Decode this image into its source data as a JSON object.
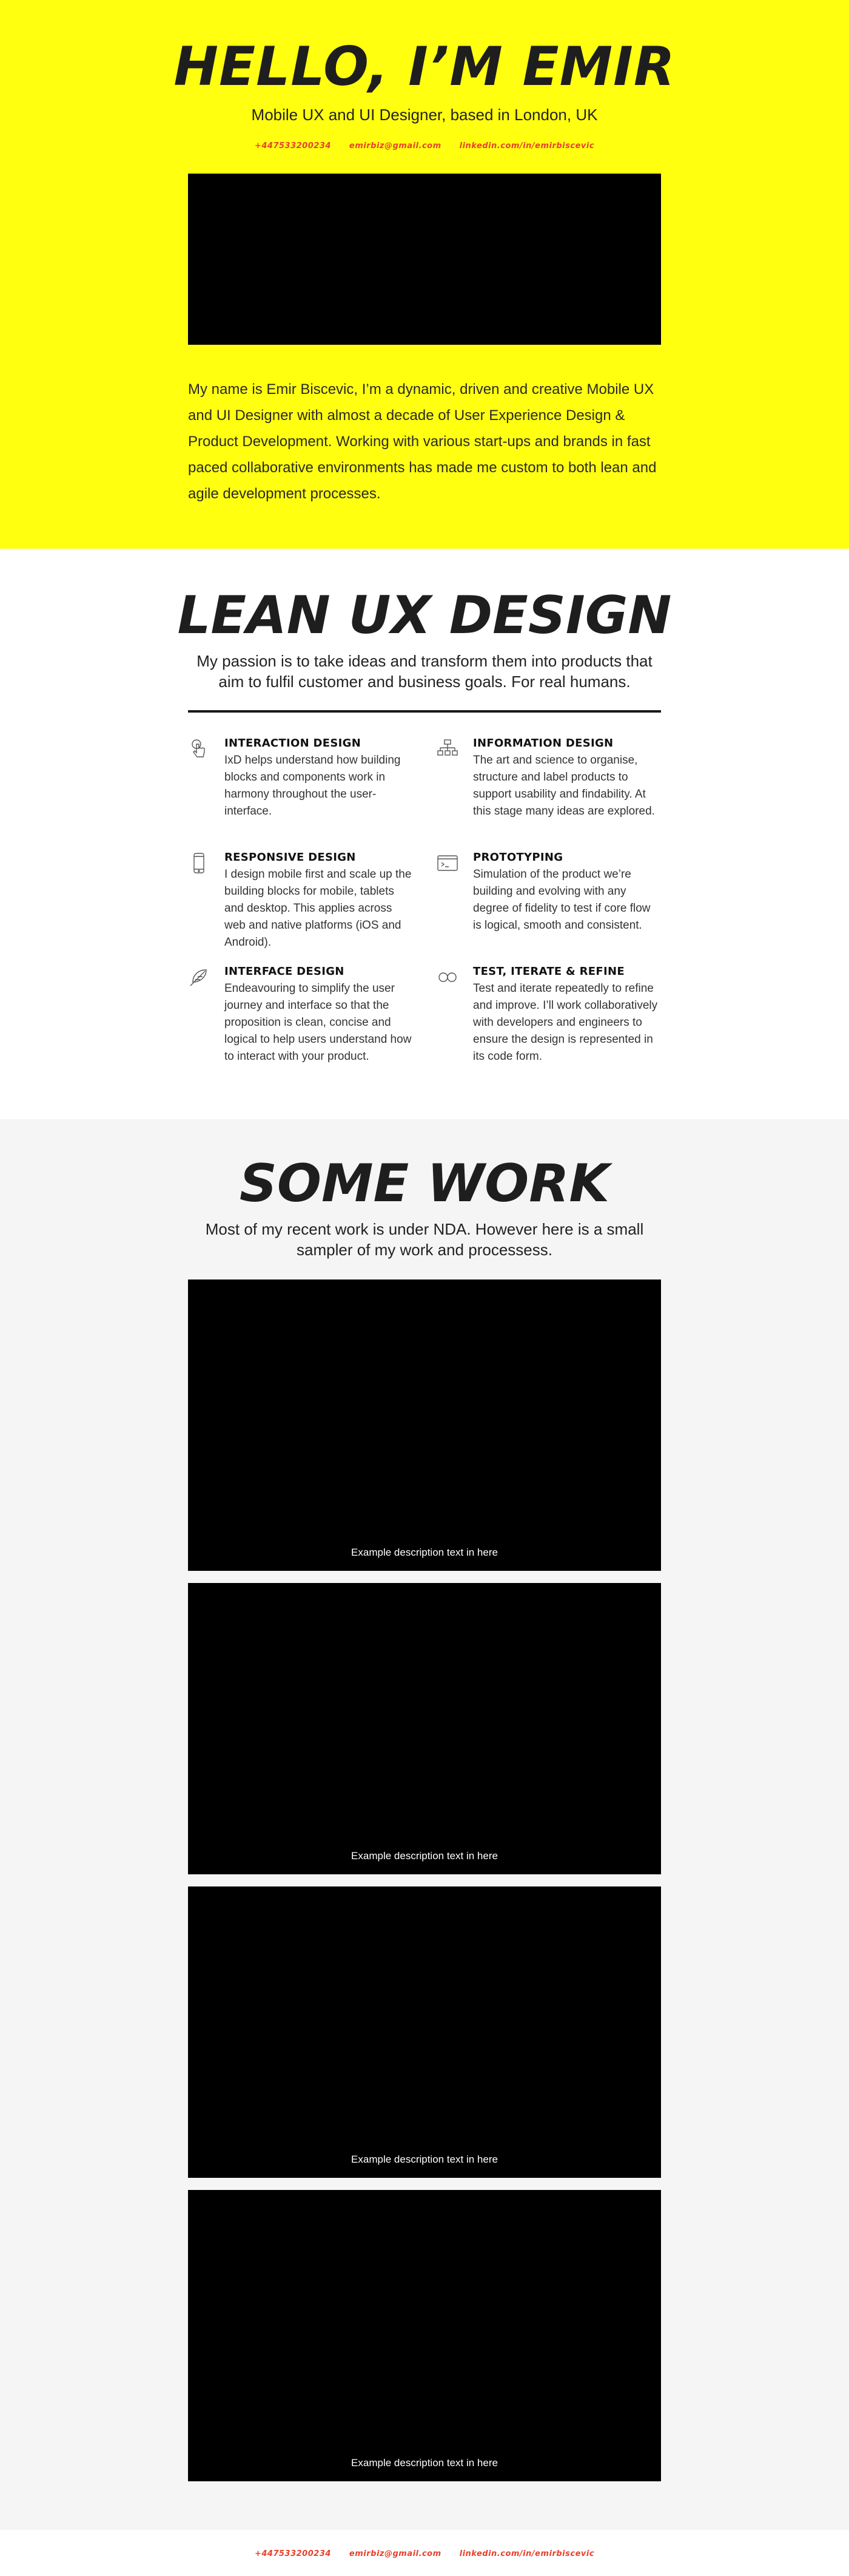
{
  "hero": {
    "title": "HELLO, I’M EMIR",
    "subtitle": "Mobile UX and UI Designer, based in London, UK",
    "contacts": [
      "+447533200234",
      "emirbiz@gmail.com",
      "linkedin.com/in/emirbiscevic"
    ],
    "bio": "My name is Emir Biscevic, I’m a dynamic, driven and creative Mobile UX and UI Designer with almost a decade of User Experience Design & Product Development. Working with various start-ups and brands in fast paced collaborative environments has made me custom to both lean and agile development processes."
  },
  "lean": {
    "title": "LEAN UX DESIGN",
    "intro": "My passion is to take ideas and transform them into products that aim to fulfil customer and business goals. For real humans.",
    "services": [
      {
        "icon": "touch-icon",
        "title": "INTERACTION DESIGN",
        "text": "IxD helps understand how building blocks and components work in harmony throughout the user-interface."
      },
      {
        "icon": "sitemap-icon",
        "title": "INFORMATION DESIGN",
        "text": "The art and science to organise, structure and label products to support usability and findability. At this stage many ideas are explored."
      },
      {
        "icon": "mobile-icon",
        "title": "RESPONSIVE DESIGN",
        "text": "I design mobile first and scale up the building blocks for mobile, tablets and desktop. This applies across web and native platforms (iOS and Android)."
      },
      {
        "icon": "browser-icon",
        "title": "PROTOTYPING",
        "text": "Simulation of the product we’re building and evolving with any degree of fidelity to test if core flow is logical, smooth and consistent."
      },
      {
        "icon": "feather-icon",
        "title": "INTERFACE DESIGN",
        "text": "Endeavouring to simplify the user journey and interface so that the proposition is clean, concise and logical to help users understand how to interact with your product."
      },
      {
        "icon": "infinity-icon",
        "title": "TEST, ITERATE & REFINE",
        "text": "Test and iterate repeatedly to refine and improve. I’ll work collaboratively with developers and engineers to ensure the design is represented in its code form."
      }
    ]
  },
  "work": {
    "title": "SOME WORK",
    "intro": "Most of my recent work is under NDA. However here is a small sampler of my work and processess.",
    "items": [
      {
        "caption": "Example description text in here"
      },
      {
        "caption": "Example description text in here"
      },
      {
        "caption": "Example description text in here"
      },
      {
        "caption": "Example description text in here"
      }
    ]
  },
  "footer": {
    "contacts": [
      "+447533200234",
      "emirbiz@gmail.com",
      "linkedin.com/in/emirbiscevic"
    ]
  },
  "colors": {
    "hero_bg": "#ffff0f",
    "accent_link": "#e8412c",
    "work_bg": "#f5f5f5"
  }
}
